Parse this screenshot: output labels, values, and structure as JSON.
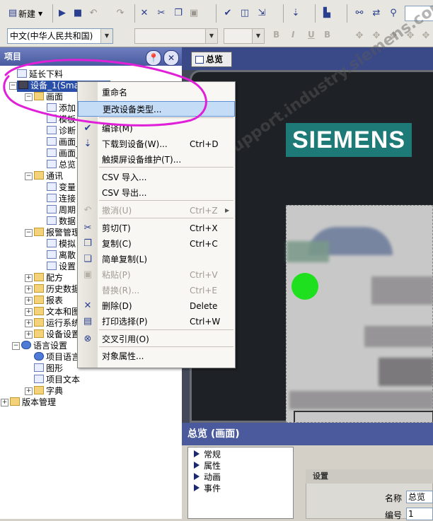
{
  "toolbar": {
    "new_label": "新建",
    "language_combo": "中文(中华人民共和国)",
    "font_combo": "",
    "size_combo": "",
    "right_input": "",
    "format_labels": [
      "B",
      "I",
      "U",
      "B"
    ]
  },
  "project": {
    "header": "项目",
    "tree": [
      {
        "label": "延长下料",
        "icon": "project"
      },
      {
        "label": "设备_1(Smart...",
        "icon": "device"
      },
      {
        "label": "画面",
        "icon": "folder"
      },
      {
        "label": "添加",
        "icon": "add"
      },
      {
        "label": "模板",
        "icon": "screen"
      },
      {
        "label": "诊断",
        "icon": "screen"
      },
      {
        "label": "画面_",
        "icon": "screen"
      },
      {
        "label": "画面_",
        "icon": "screen"
      },
      {
        "label": "总览",
        "icon": "screen"
      },
      {
        "label": "通讯",
        "icon": "folder"
      },
      {
        "label": "变量",
        "icon": "tags"
      },
      {
        "label": "连接",
        "icon": "connection"
      },
      {
        "label": "周期",
        "icon": "cycle"
      },
      {
        "label": "数据",
        "icon": "data"
      },
      {
        "label": "报警管理",
        "icon": "folder"
      },
      {
        "label": "模拟",
        "icon": "alarm"
      },
      {
        "label": "离散",
        "icon": "alarm"
      },
      {
        "label": "设置",
        "icon": "settings"
      },
      {
        "label": "配方",
        "icon": "folder"
      },
      {
        "label": "历史数据",
        "icon": "folder"
      },
      {
        "label": "报表",
        "icon": "folder"
      },
      {
        "label": "文本和图",
        "icon": "folder"
      },
      {
        "label": "运行系统",
        "icon": "folder"
      },
      {
        "label": "设备设置",
        "icon": "folder"
      },
      {
        "label": "语言设置",
        "icon": "globe"
      },
      {
        "label": "项目语言",
        "icon": "globe"
      },
      {
        "label": "图形",
        "icon": "graphic"
      },
      {
        "label": "项目文本",
        "icon": "text"
      },
      {
        "label": "字典",
        "icon": "folder"
      },
      {
        "label": "版本管理",
        "icon": "folder"
      }
    ]
  },
  "context_menu": {
    "items": [
      {
        "label": "重命名",
        "shortcut": "",
        "icon": "",
        "enabled": true
      },
      {
        "label": "更改设备类型...",
        "shortcut": "",
        "icon": "",
        "enabled": true,
        "highlighted": true
      },
      {
        "label": "编译(M)",
        "shortcut": "",
        "icon": "check-icon",
        "enabled": true
      },
      {
        "label": "下载到设备(W)...",
        "shortcut": "Ctrl+D",
        "icon": "download-icon",
        "enabled": true
      },
      {
        "label": "触摸屏设备维护(T)...",
        "shortcut": "",
        "icon": "",
        "enabled": true
      },
      {
        "label": "CSV 导入...",
        "shortcut": "",
        "icon": "",
        "enabled": true
      },
      {
        "label": "CSV 导出...",
        "shortcut": "",
        "icon": "",
        "enabled": true
      },
      {
        "label": "撤消(U)",
        "shortcut": "Ctrl+Z",
        "icon": "undo-icon",
        "enabled": false
      },
      {
        "label": "剪切(T)",
        "shortcut": "Ctrl+X",
        "icon": "cut-icon",
        "enabled": true
      },
      {
        "label": "复制(C)",
        "shortcut": "Ctrl+C",
        "icon": "copy-icon",
        "enabled": true
      },
      {
        "label": "简单复制(L)",
        "shortcut": "",
        "icon": "simple-copy-icon",
        "enabled": true
      },
      {
        "label": "粘贴(P)",
        "shortcut": "Ctrl+V",
        "icon": "paste-icon",
        "enabled": false
      },
      {
        "label": "替换(R)...",
        "shortcut": "Ctrl+E",
        "icon": "",
        "enabled": false
      },
      {
        "label": "删除(D)",
        "shortcut": "Delete",
        "icon": "delete-icon",
        "enabled": true
      },
      {
        "label": "打印选择(P)",
        "shortcut": "Ctrl+W",
        "icon": "print-icon",
        "enabled": true
      },
      {
        "label": "交叉引用(O)",
        "shortcut": "",
        "icon": "cross-ref-icon",
        "enabled": true
      },
      {
        "label": "对象属性...",
        "shortcut": "",
        "icon": "",
        "enabled": true
      }
    ]
  },
  "editor": {
    "tab_label": "总览",
    "logo_text": "SIEMENS",
    "watermark": "找答案 门子工业 support.industry.siemens.com/cs"
  },
  "properties": {
    "header": "总览 (画面)",
    "categories": [
      "常规",
      "属性",
      "动画",
      "事件"
    ],
    "settings_title": "设置",
    "name_label": "名称",
    "name_value": "总览",
    "number_label": "编号",
    "number_value": "1"
  },
  "colors": {
    "selection": "#2a4fa8",
    "menu_highlight": "#c5dcf7",
    "logo_bg": "#1e7a77",
    "annotation": "#e020d8",
    "led": "#1ee01e"
  }
}
